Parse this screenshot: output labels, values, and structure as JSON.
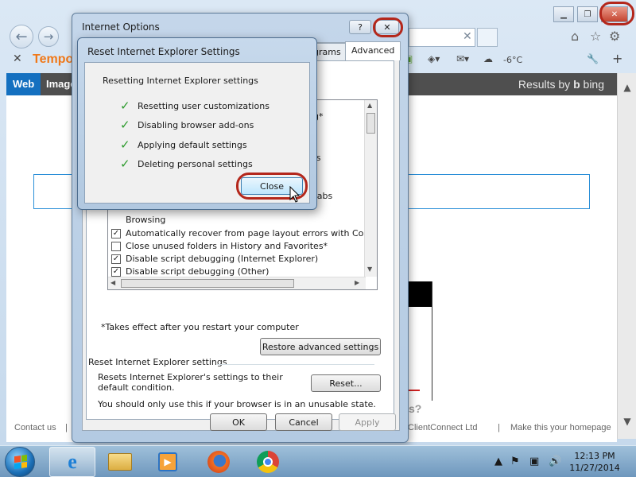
{
  "browser": {
    "search_text": "Tempo",
    "weather": "-6°C",
    "page_nav": {
      "tabs": [
        "Web",
        "Images"
      ],
      "results_by": "Results by",
      "bing": "bing"
    },
    "footer": {
      "contact": "Contact us",
      "provider": "ClientConnect Ltd",
      "homepage": "Make this your homepage"
    },
    "page_fragment_q": "s?"
  },
  "internet_options": {
    "title": "Internet Options",
    "help_label": "?",
    "close_label": "✕",
    "tabs": [
      {
        "label": "grams",
        "active": false
      },
      {
        "label": "Advanced",
        "active": true
      }
    ],
    "settings_fragments": [
      {
        "text": "ing*"
      },
      {
        "text": "abs"
      },
      {
        "text": "es"
      },
      {
        "text": "d tabs"
      }
    ],
    "browsing_header": "Browsing",
    "settings": [
      {
        "label": "Automatically recover from page layout errors with Compa",
        "checked": true
      },
      {
        "label": "Close unused folders in History and Favorites*",
        "checked": false
      },
      {
        "label": "Disable script debugging (Internet Explorer)",
        "checked": true
      },
      {
        "label": "Disable script debugging (Other)",
        "checked": true
      }
    ],
    "restart_note": "*Takes effect after you restart your computer",
    "restore_button": "Restore advanced settings",
    "reset_group_label": "Reset Internet Explorer settings",
    "reset_description": "Resets Internet Explorer's settings to their default condition.",
    "reset_button": "Reset...",
    "warning": "You should only use this if your browser is in an unusable state.",
    "ok_button": "OK",
    "cancel_button": "Cancel",
    "apply_button": "Apply"
  },
  "reset_dialog": {
    "title": "Reset Internet Explorer Settings",
    "heading": "Resetting Internet Explorer settings",
    "steps": [
      "Resetting user customizations",
      "Disabling browser add-ons",
      "Applying default settings",
      "Deleting personal settings"
    ],
    "close_button": "Close"
  },
  "taskbar": {
    "time": "12:13 PM",
    "date": "11/27/2014"
  },
  "colors": {
    "highlight": "#b4271b",
    "bing_active": "#1470c0",
    "check": "#2c9a2c"
  }
}
